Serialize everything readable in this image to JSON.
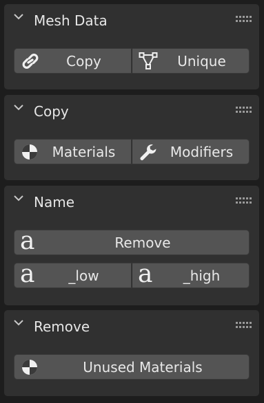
{
  "panels": {
    "mesh_data": {
      "title": "Mesh Data",
      "copy_button": "Copy",
      "unique_button": "Unique"
    },
    "copy": {
      "title": "Copy",
      "materials_button": "Materials",
      "modifiers_button": "Modifiers"
    },
    "name": {
      "title": "Name",
      "remove_button": "Remove",
      "low_button": "_low",
      "high_button": "_high",
      "icon_glyph": "a"
    },
    "remove": {
      "title": "Remove",
      "unused_materials_button": "Unused Materials"
    }
  },
  "icons": {
    "collapse": "chevron-down-icon",
    "drag": "drag-grip-icon",
    "link": "link-icon",
    "unique": "vertex-triangle-icon",
    "material": "material-sphere-icon",
    "modifier": "wrench-icon",
    "name": "font-a-icon"
  },
  "colors": {
    "background": "#1d1d1d",
    "panel": "#303030",
    "button": "#545454",
    "text": "#e6e6e6"
  }
}
